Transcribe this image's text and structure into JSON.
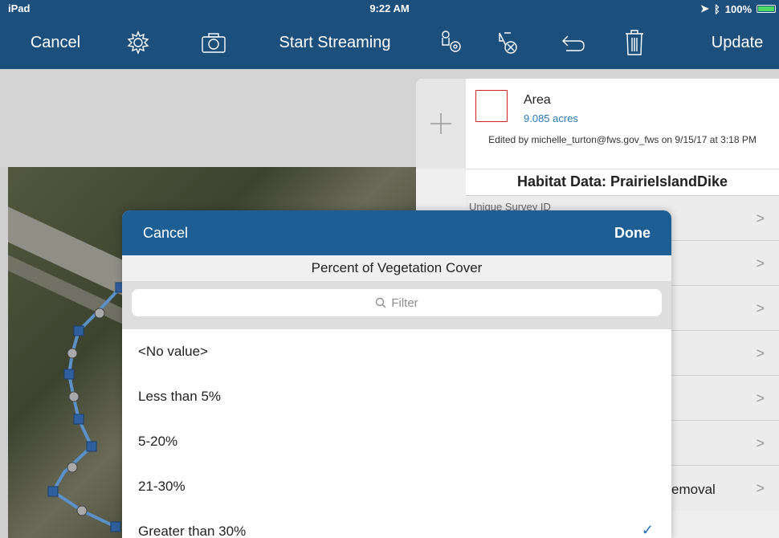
{
  "status_bar": {
    "device": "iPad",
    "time": "9:22 AM",
    "battery_percent": "100%",
    "battery_level": 1.0
  },
  "toolbar": {
    "cancel_label": "Cancel",
    "streaming_label": "Start Streaming",
    "update_label": "Update",
    "icons": [
      "gear-icon",
      "camera-icon",
      "gps-settings-icon",
      "clear-vertices-icon",
      "undo-icon",
      "trash-icon"
    ]
  },
  "feature_panel": {
    "area_title": "Area",
    "area_value": "9.085 acres",
    "edited_info": "Edited by michelle_turton@fws.gov_fws on 9/15/17 at 3:18 PM",
    "habitat_title": "Habitat Data: PrairieIslandDike",
    "fields": [
      {
        "label": "Unique Survey ID",
        "value": ""
      },
      {
        "label": "",
        "value": ""
      },
      {
        "label": "",
        "value": ""
      },
      {
        "label": "",
        "value": ""
      },
      {
        "label": "",
        "value": ""
      },
      {
        "label": "",
        "value": ""
      },
      {
        "label": "",
        "value": "emoval"
      }
    ],
    "swatch_color": "#cc2222"
  },
  "picker": {
    "cancel_label": "Cancel",
    "done_label": "Done",
    "title": "Percent of Vegetation Cover",
    "filter_placeholder": "Filter",
    "options": [
      {
        "label": "<No value>",
        "selected": false
      },
      {
        "label": "Less than 5%",
        "selected": false
      },
      {
        "label": "5-20%",
        "selected": false
      },
      {
        "label": "21-30%",
        "selected": false
      },
      {
        "label": "Greater than 30%",
        "selected": true
      }
    ],
    "check_mark": "✓"
  },
  "colors": {
    "nav_bar": "#1d4f7c",
    "modal_header": "#1d5e95",
    "accent_blue": "#2a7ab5",
    "battery_fill": "#4cd964"
  }
}
